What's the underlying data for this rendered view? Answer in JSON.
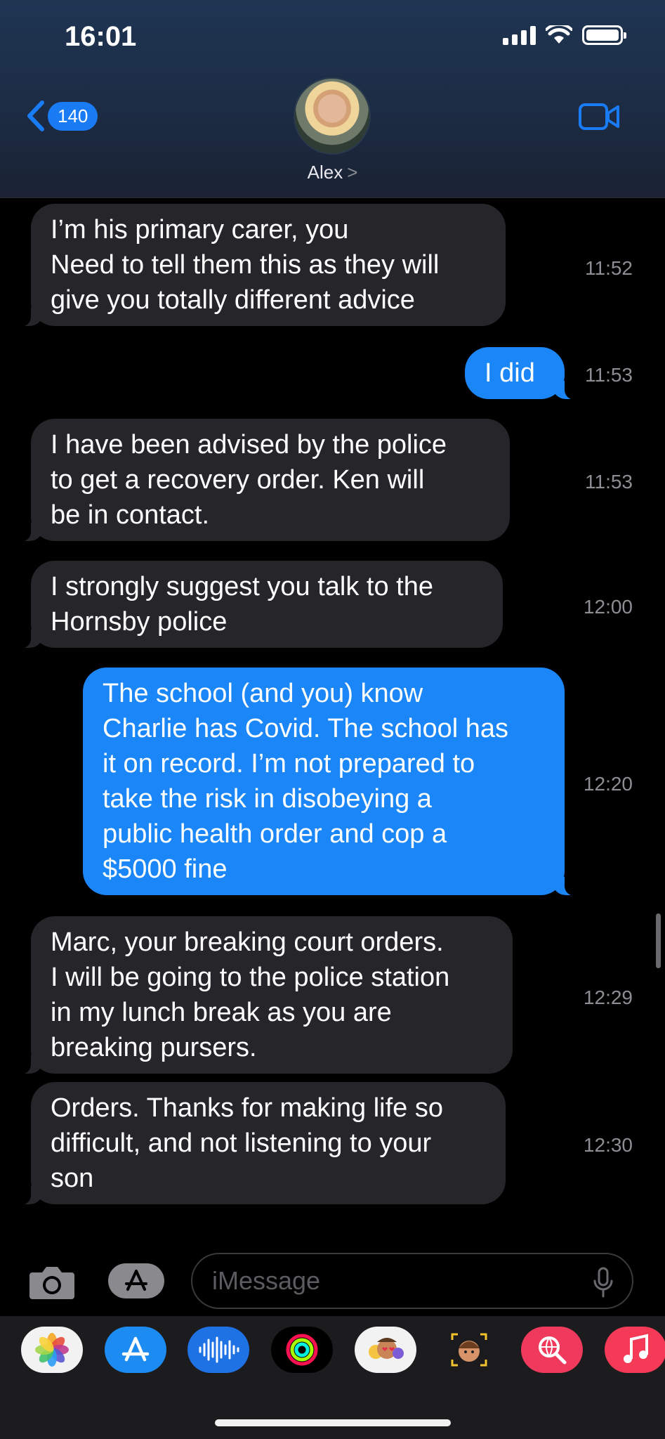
{
  "status_bar": {
    "time": "16:01"
  },
  "header": {
    "back_count": "140",
    "contact_name": "Alex",
    "contact_chevron": ">"
  },
  "messages": [
    {
      "direction": "incoming",
      "text": "I’m his primary carer, you\nNeed to tell them this as they will\ngive you totally different advice",
      "time": "11:52"
    },
    {
      "direction": "outgoing",
      "text": "I did",
      "time": "11:53"
    },
    {
      "direction": "incoming",
      "text": "I have been advised by the police\nto get a recovery order. Ken will\nbe in contact.",
      "time": "11:53"
    },
    {
      "direction": "incoming",
      "text": "I strongly suggest you talk to the\nHornsby police",
      "time": "12:00"
    },
    {
      "direction": "outgoing",
      "text": "The school (and you) know\nCharlie has Covid. The school has\nit on record. I’m not prepared to\ntake the risk in disobeying a\npublic health order and cop a\n$5000 fine",
      "time": "12:20"
    },
    {
      "direction": "incoming",
      "text": "Marc, your breaking court orders.\nI will be going to the police station\nin my lunch break as you are\nbreaking pursers.",
      "time": "12:29"
    },
    {
      "direction": "incoming",
      "text": "Orders. Thanks for making life so\ndifficult, and not listening to your\nson",
      "time": "12:30"
    }
  ],
  "composer": {
    "placeholder": "iMessage"
  },
  "app_tray": [
    {
      "name": "photos-app-icon"
    },
    {
      "name": "app-store-icon"
    },
    {
      "name": "audio-message-icon"
    },
    {
      "name": "activity-icon"
    },
    {
      "name": "memoji-stickers-icon"
    },
    {
      "name": "animoji-icon"
    },
    {
      "name": "image-search-icon"
    },
    {
      "name": "music-icon"
    }
  ],
  "colors": {
    "incoming_bubble": "#26262a",
    "outgoing_bubble": "#1a86f7",
    "accent": "#1a7cf5",
    "timestamp": "#8d8d93"
  }
}
